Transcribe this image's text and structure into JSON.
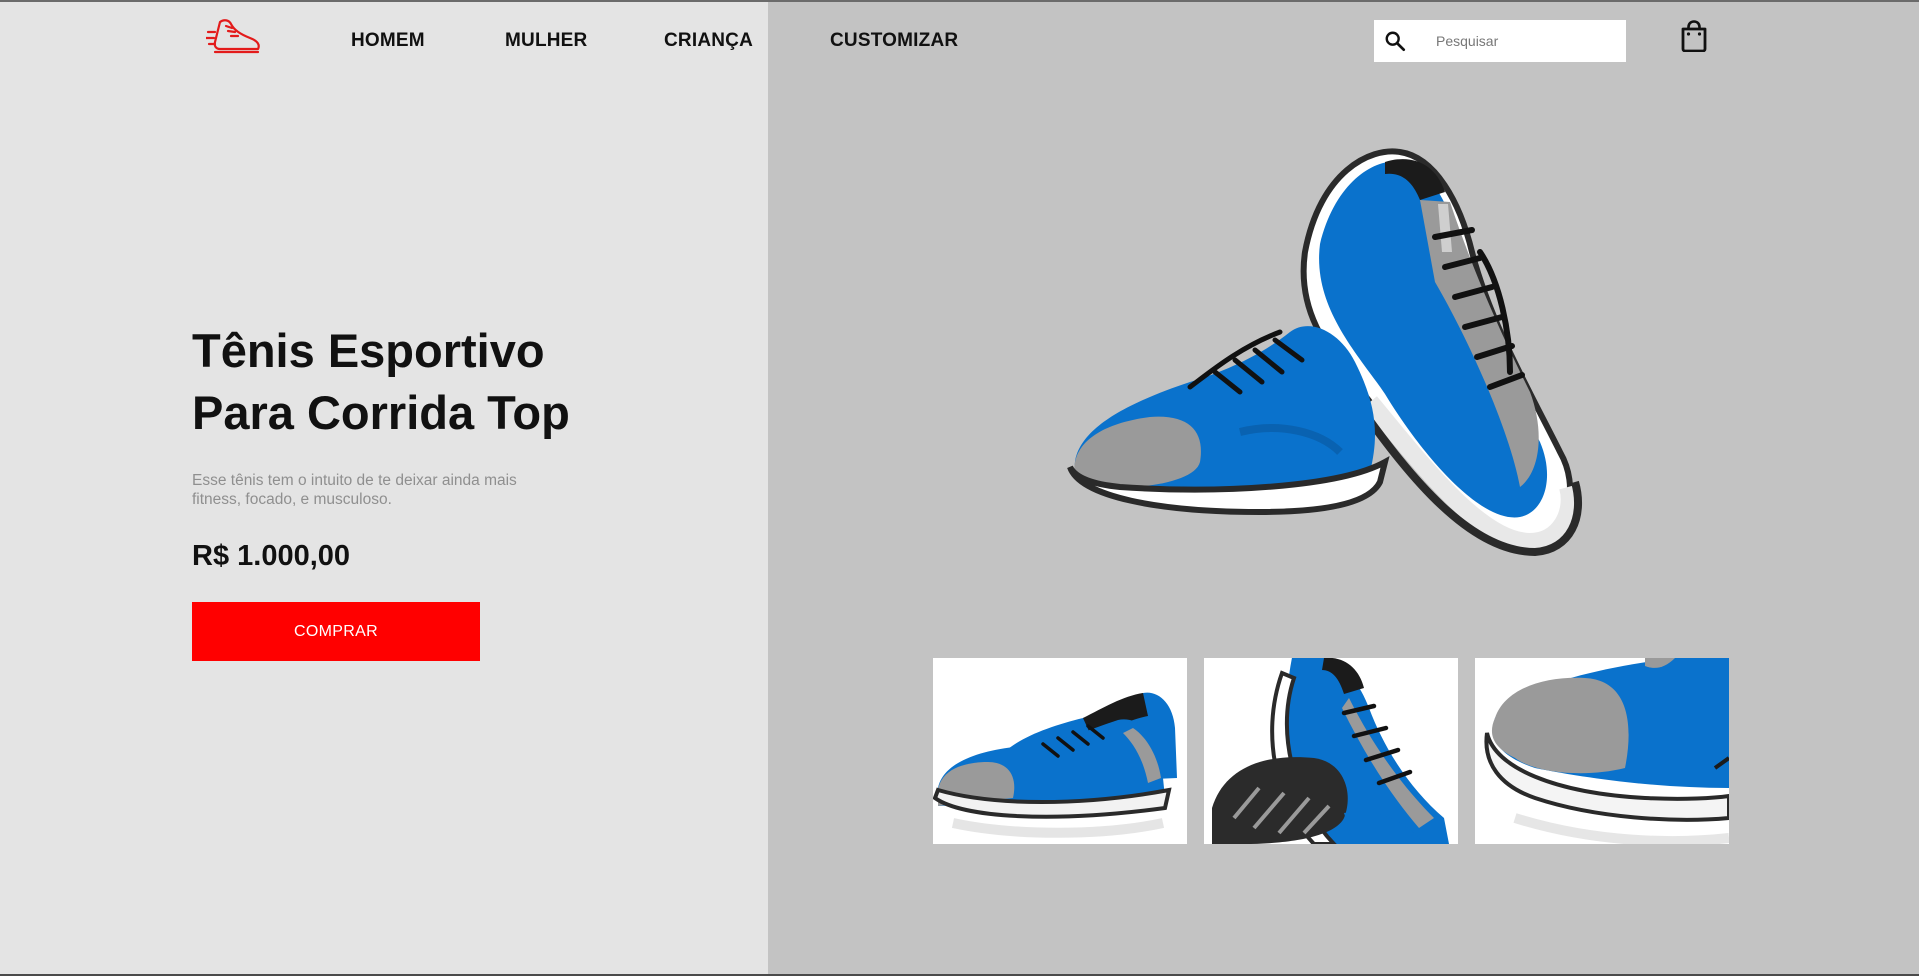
{
  "header": {
    "logo_icon": "running-shoe-icon",
    "nav": [
      {
        "label": "HOMEM"
      },
      {
        "label": "MULHER"
      },
      {
        "label": "CRIANÇA"
      },
      {
        "label": "CUSTOMIZAR"
      }
    ],
    "search": {
      "placeholder": "Pesquisar",
      "value": "",
      "icon": "search-icon"
    },
    "cart_icon": "shopping-bag-icon"
  },
  "hero": {
    "title_line1": "Tênis Esportivo",
    "title_line2": "Para Corrida Top",
    "description": "Esse tênis tem o intuito de te deixar ainda mais fitness, focado, e musculoso.",
    "price": "R$ 1.000,00",
    "buy_label": "COMPRAR"
  },
  "colors": {
    "left_background": "#e4e4e4",
    "right_background": "#c3c3c3",
    "accent": "#ff0000",
    "shoe_blue": "#0a72cc",
    "shoe_grey": "#9a9a9a"
  },
  "gallery": {
    "main_image": "blue-running-shoes-pair",
    "thumbnails": [
      {
        "image": "shoes-side-view"
      },
      {
        "image": "shoes-sole-view"
      },
      {
        "image": "shoe-toe-closeup"
      }
    ]
  }
}
